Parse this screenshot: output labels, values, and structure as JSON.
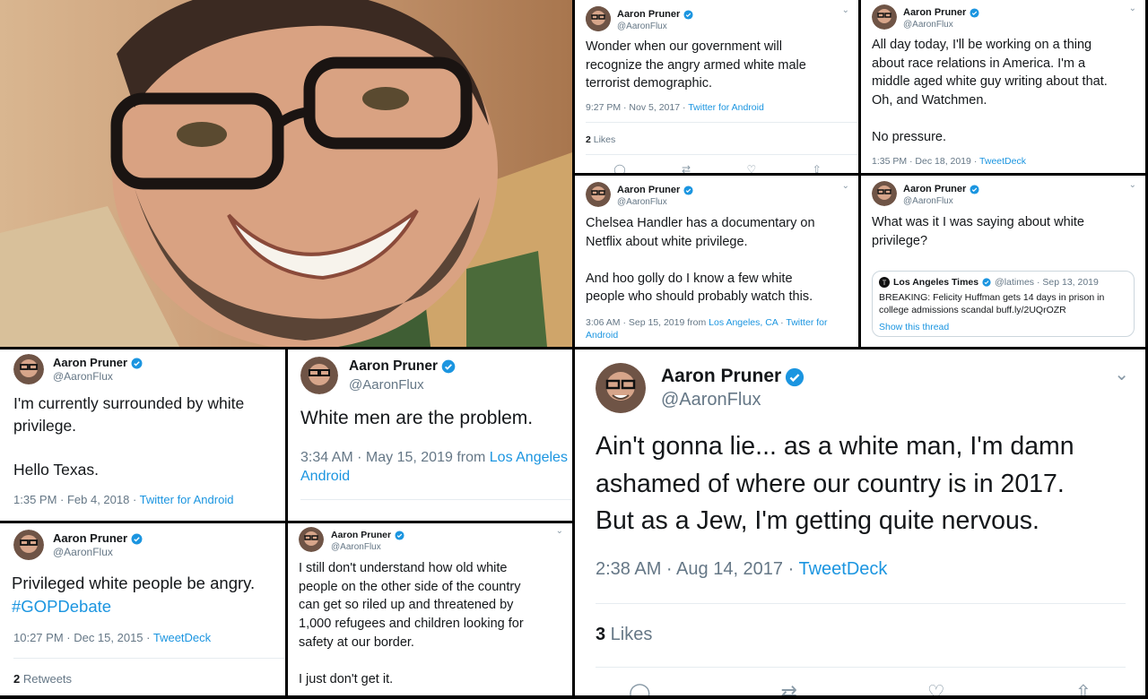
{
  "brand_color": "#1b95e0",
  "tweets": [
    {
      "name": "Aaron Pruner",
      "handle": "@AaronFlux",
      "text": "Wonder when our government will\nrecognize the angry armed white male\nterrorist demographic.",
      "time": "9:27 PM · Nov 5, 2017 · ",
      "source": "Twitter for Android",
      "likes_count": "2",
      "likes_label": " Likes"
    },
    {
      "name": "Aaron Pruner",
      "handle": "@AaronFlux",
      "text": "All day today, I'll be working on a thing\nabout race relations in America. I'm a\nmiddle aged white guy writing about that.\nOh, and Watchmen.\n\nNo pressure.",
      "time": "1:35 PM · Dec 18, 2019 · ",
      "source": "TweetDeck"
    },
    {
      "name": "Aaron Pruner",
      "handle": "@AaronFlux",
      "text": "Chelsea Handler has a documentary on\nNetflix about white privilege.\n\nAnd hoo golly do I know a few white\npeople who should probably watch this.",
      "time": "3:06 AM · Sep 15, 2019 from ",
      "location": "Los Angeles, CA",
      "sep": " · ",
      "source": "Twitter for Android"
    },
    {
      "name": "Aaron Pruner",
      "handle": "@AaronFlux",
      "text": "What was it I was saying about white\nprivilege?",
      "quote": {
        "name": "Los Angeles Times",
        "meta": "@latimes · Sep 13, 2019",
        "text": "BREAKING: Felicity Huffman gets 14 days in prison in\ncollege admissions scandal buff.ly/2UQrOZR",
        "show_thread": "Show this thread"
      }
    },
    {
      "name": "Aaron Pruner",
      "handle": "@AaronFlux",
      "text": "I'm currently surrounded by white\nprivilege.\n\nHello Texas.",
      "time": "1:35 PM · Feb 4, 2018 · ",
      "source": "Twitter for Android"
    },
    {
      "name": "Aaron Pruner",
      "handle": "@AaronFlux",
      "text": "White men are the problem.",
      "time": "3:34 AM · May 15, 2019 from ",
      "location": "Los Angeles",
      "source2": "Android"
    },
    {
      "name": "Aaron Pruner",
      "handle": "@AaronFlux",
      "text": "Privileged white people be angry.",
      "hashtag": "#GOPDebate",
      "time": "10:27 PM · Dec 15, 2015 · ",
      "source": "TweetDeck",
      "retweets_count": "2",
      "retweets_label": " Retweets"
    },
    {
      "name": "Aaron Pruner",
      "handle": "@AaronFlux",
      "text": "I still don't understand how old white\npeople on the other side of the country\ncan get so riled up and threatened by\n1,000 refugees and children looking for\nsafety at our border.\n\nI just don't get it."
    },
    {
      "name": "Aaron Pruner",
      "handle": "@AaronFlux",
      "text": "Ain't gonna lie... as a white man, I'm damn\nashamed of where our country is in 2017.\nBut as a Jew, I'm getting quite nervous.",
      "time": "2:38 AM · Aug 14, 2017 · ",
      "source": "TweetDeck",
      "likes_count": "3",
      "likes_label": " Likes"
    }
  ]
}
